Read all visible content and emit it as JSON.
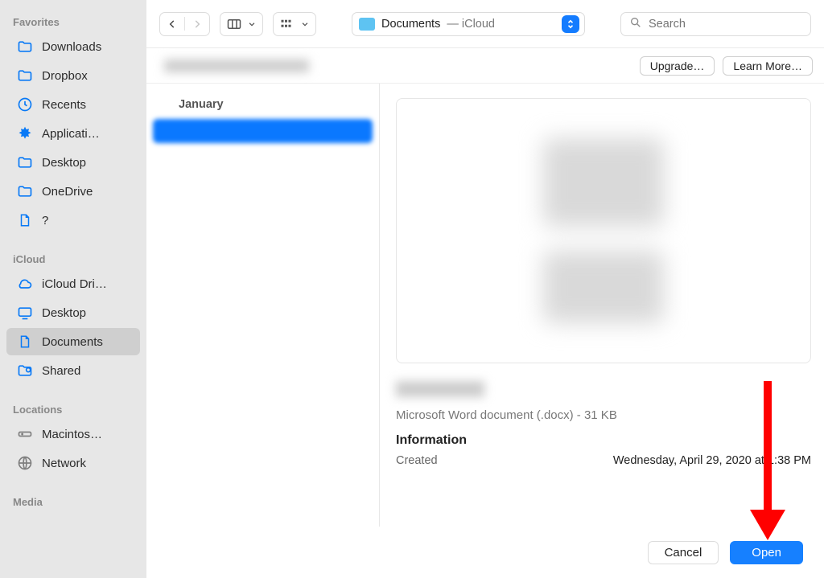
{
  "sidebar": {
    "sections": [
      {
        "title": "Favorites",
        "items": [
          {
            "label": "Downloads",
            "icon": "folder-icon"
          },
          {
            "label": "Dropbox",
            "icon": "folder-icon"
          },
          {
            "label": "Recents",
            "icon": "clock-icon"
          },
          {
            "label": "Applicati…",
            "icon": "apps-icon"
          },
          {
            "label": "Desktop",
            "icon": "folder-icon"
          },
          {
            "label": "OneDrive",
            "icon": "folder-icon"
          },
          {
            "label": "?",
            "icon": "document-icon"
          }
        ]
      },
      {
        "title": "iCloud",
        "items": [
          {
            "label": "iCloud Dri…",
            "icon": "cloud-icon"
          },
          {
            "label": "Desktop",
            "icon": "desktop-icon"
          },
          {
            "label": "Documents",
            "icon": "document-icon",
            "selected": true
          },
          {
            "label": "Shared",
            "icon": "shared-icon"
          }
        ]
      },
      {
        "title": "Locations",
        "items": [
          {
            "label": "Macintos…",
            "icon": "disk-icon",
            "muted": true
          },
          {
            "label": "Network",
            "icon": "globe-icon",
            "muted": true
          }
        ]
      },
      {
        "title": "Media",
        "items": []
      }
    ]
  },
  "toolbar": {
    "location_name": "Documents",
    "location_sub": " — iCloud",
    "search_placeholder": "Search"
  },
  "banner": {
    "title_placeholder": "",
    "upgrade_label": "Upgrade…",
    "learn_more_label": "Learn More…"
  },
  "file_list": {
    "date_heading": "January"
  },
  "preview": {
    "type_line": "Microsoft Word document (.docx) - 31 KB",
    "info_heading": "Information",
    "created_label": "Created",
    "created_value": "Wednesday, April 29, 2020 at 1:38 PM"
  },
  "footer": {
    "cancel_label": "Cancel",
    "open_label": "Open"
  }
}
